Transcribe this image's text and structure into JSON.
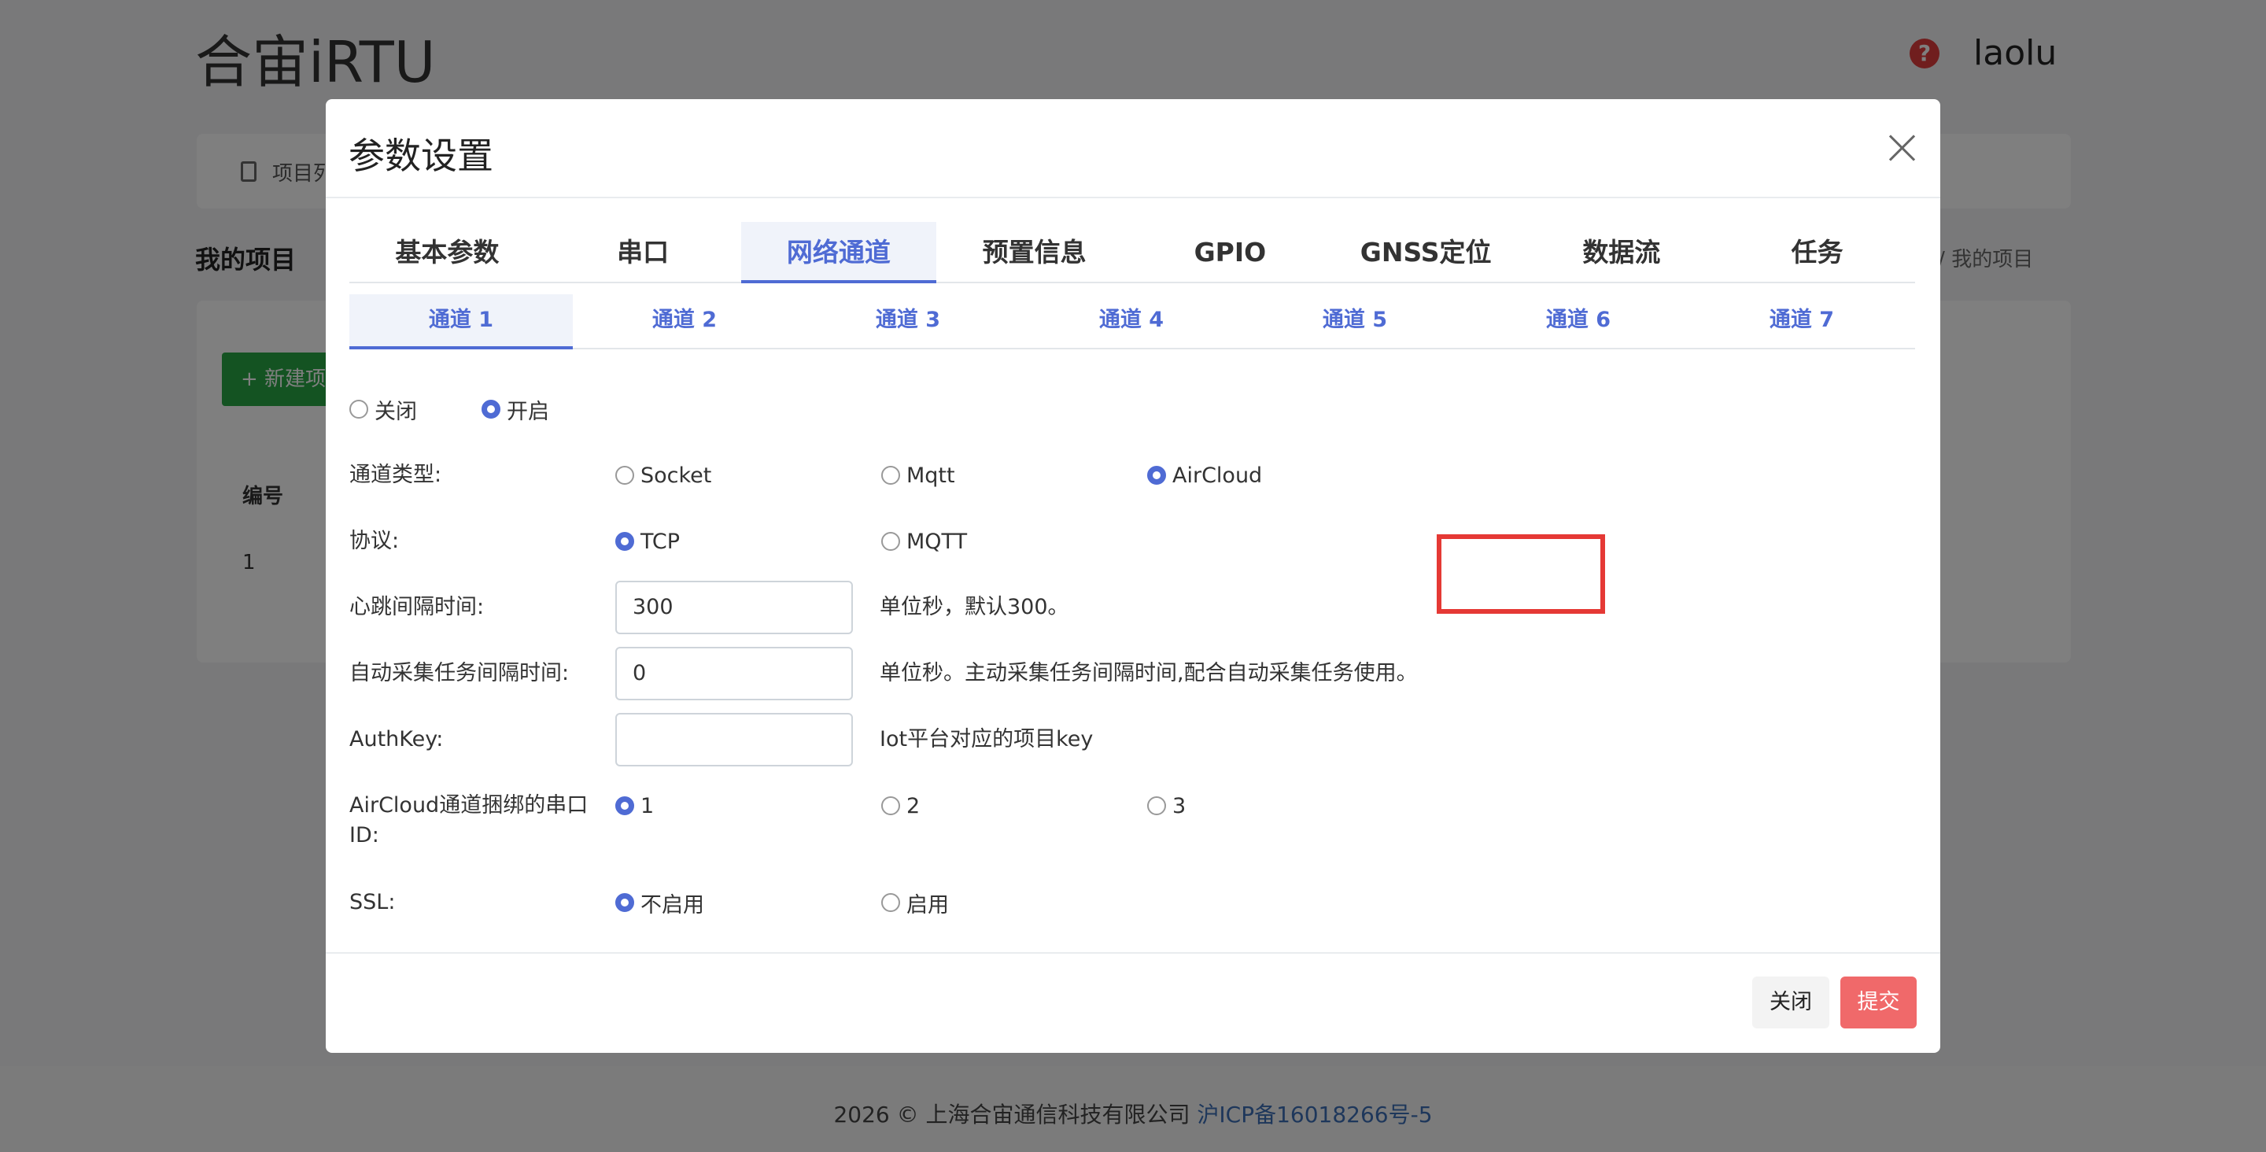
{
  "app": {
    "title": "合宙iRTU",
    "user": "laolu",
    "help_icon": "question-circle-icon"
  },
  "nav": {
    "item_label": "项目列"
  },
  "page": {
    "section_title": "我的项目",
    "breadcrumb": "TU / 我的项目"
  },
  "card": {
    "new_button": "+ 新建项",
    "col_header": "编号",
    "row1_id": "1"
  },
  "footer": {
    "copyright": "2026 © 上海合宙通信科技有限公司 ",
    "icp": "沪ICP备16018266号-5"
  },
  "modal": {
    "title": "参数设置",
    "main_tabs": [
      "基本参数",
      "串口",
      "网络通道",
      "预置信息",
      "GPIO",
      "GNSS定位",
      "数据流",
      "任务"
    ],
    "sub_tabs": [
      "通道 1",
      "通道 2",
      "通道 3",
      "通道 4",
      "通道 5",
      "通道 6",
      "通道 7"
    ],
    "enable": {
      "off": "关闭",
      "on": "开启"
    },
    "channel_type": {
      "label": "通道类型:",
      "options": [
        "Socket",
        "Mqtt",
        "AirCloud"
      ]
    },
    "protocol": {
      "label": "协议:",
      "options": [
        "TCP",
        "MQTT"
      ]
    },
    "heartbeat": {
      "label": "心跳间隔时间:",
      "value": "300",
      "hint": "单位秒，默认300。"
    },
    "auto_collect": {
      "label": "自动采集任务间隔时间:",
      "value": "0",
      "hint": "单位秒。主动采集任务间隔时间,配合自动采集任务使用。"
    },
    "authkey": {
      "label": "AuthKey:",
      "value": "",
      "hint": "Iot平台对应的项目key"
    },
    "serial_id": {
      "label": "AirCloud通道捆绑的串口ID:",
      "options": [
        "1",
        "2",
        "3"
      ]
    },
    "ssl": {
      "label": "SSL:",
      "options": [
        "不启用",
        "启用"
      ]
    },
    "buttons": {
      "close": "关闭",
      "submit": "提交"
    }
  },
  "colors": {
    "accent": "#4f6bd4",
    "submit": "#f0696a",
    "highlight": "#e53935"
  }
}
